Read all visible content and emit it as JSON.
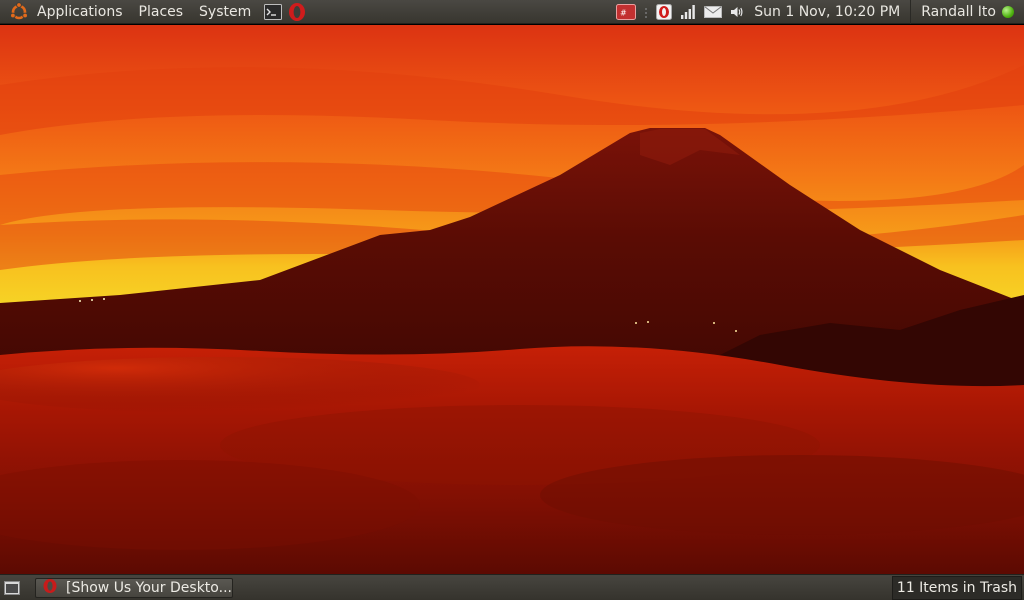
{
  "top_panel": {
    "menus": {
      "applications": "Applications",
      "places": "Places",
      "system": "System"
    },
    "clock": "Sun  1 Nov, 10:20 PM",
    "user": "Randall Ito"
  },
  "bottom_panel": {
    "task": "[Show Us Your Deskto...",
    "trash": "11 Items in Trash"
  },
  "icons": {
    "ubuntu": "ubuntu-logo-icon",
    "terminal": "terminal-icon",
    "opera": "opera-icon",
    "mail": "mail-icon",
    "network": "network-signal-icon",
    "volume": "volume-icon"
  },
  "colors": {
    "panel": "#3f3d38",
    "accent": "#e05a1c",
    "status": "#4fb30f"
  }
}
